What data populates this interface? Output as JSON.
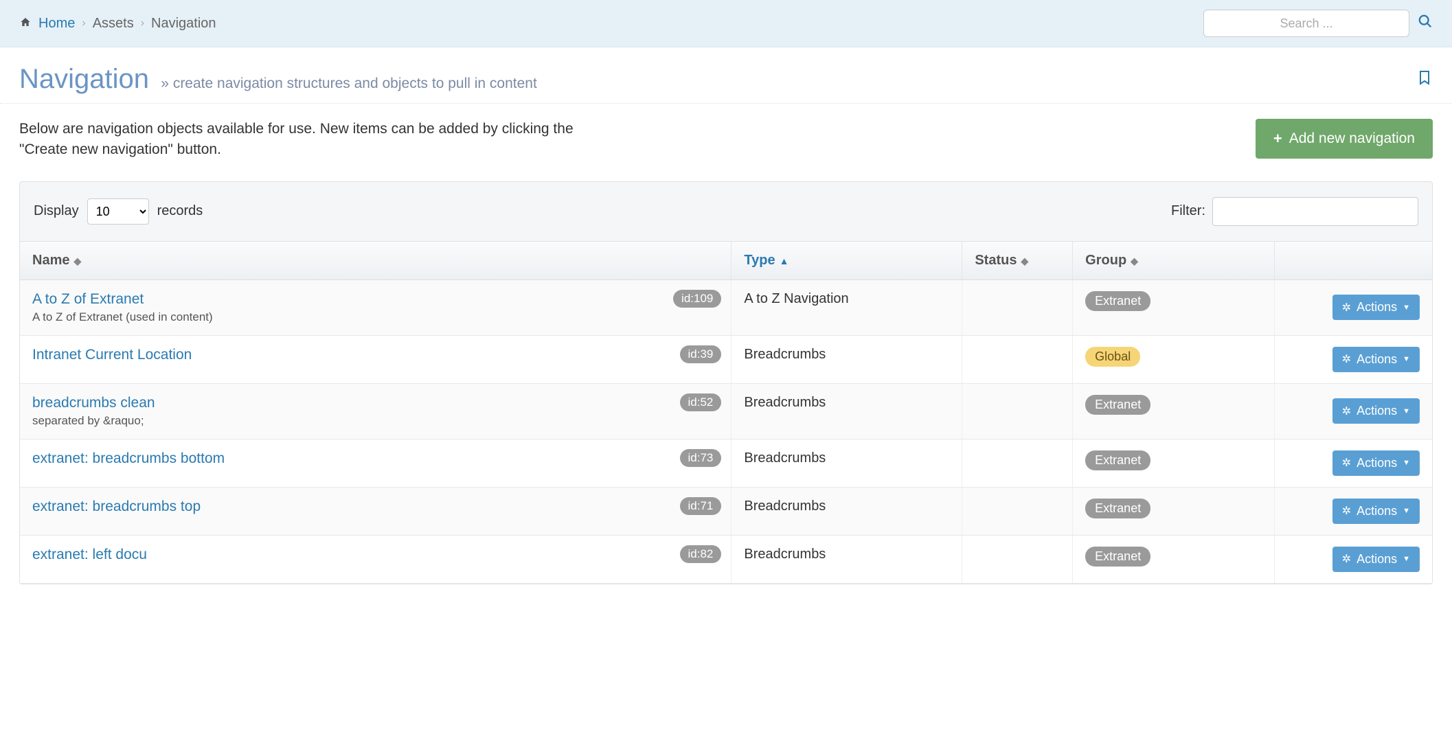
{
  "breadcrumb": {
    "home": "Home",
    "assets": "Assets",
    "current": "Navigation"
  },
  "search": {
    "placeholder": "Search ..."
  },
  "header": {
    "title": "Navigation",
    "subtitle": "create navigation structures and objects to pull in content"
  },
  "intro": "Below are navigation objects available for use. New items can be added by clicking the \"Create new navigation\" button.",
  "buttons": {
    "add": "Add new navigation",
    "actions": "Actions"
  },
  "table_controls": {
    "display_label": "Display",
    "display_value": "10",
    "records_label": "records",
    "filter_label": "Filter:"
  },
  "columns": {
    "name": "Name",
    "type": "Type",
    "status": "Status",
    "group": "Group"
  },
  "rows": [
    {
      "name": "A to Z of Extranet",
      "desc": "A to Z of Extranet (used in content)",
      "id": "id:109",
      "type": "A to Z Navigation",
      "status": "",
      "group": "Extranet",
      "group_class": ""
    },
    {
      "name": "Intranet Current Location",
      "desc": "",
      "id": "id:39",
      "type": "Breadcrumbs",
      "status": "",
      "group": "Global",
      "group_class": "global"
    },
    {
      "name": "breadcrumbs clean",
      "desc": "separated by &raquo;",
      "id": "id:52",
      "type": "Breadcrumbs",
      "status": "",
      "group": "Extranet",
      "group_class": ""
    },
    {
      "name": "extranet: breadcrumbs bottom",
      "desc": "",
      "id": "id:73",
      "type": "Breadcrumbs",
      "status": "",
      "group": "Extranet",
      "group_class": ""
    },
    {
      "name": "extranet: breadcrumbs top",
      "desc": "",
      "id": "id:71",
      "type": "Breadcrumbs",
      "status": "",
      "group": "Extranet",
      "group_class": ""
    },
    {
      "name": "extranet: left docu",
      "desc": "",
      "id": "id:82",
      "type": "Breadcrumbs",
      "status": "",
      "group": "Extranet",
      "group_class": ""
    }
  ]
}
